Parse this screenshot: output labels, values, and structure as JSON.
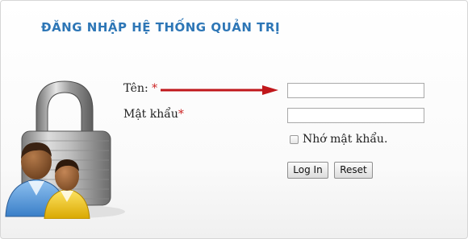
{
  "login": {
    "title": "ĐĂNG NHẬP HỆ THỐNG QUẢN TRỊ",
    "username": {
      "label": "Tên: ",
      "required_mark": "*",
      "value": ""
    },
    "password": {
      "label": "Mật khẩu",
      "required_mark": "*",
      "value": ""
    },
    "remember_label": "Nhớ mật khẩu.",
    "remember_checked": false,
    "login_button": "Log In",
    "reset_button": "Reset"
  },
  "colors": {
    "title": "#2d76b6",
    "required": "#cc2222",
    "arrow": "#c0171b"
  },
  "icons": {
    "illustration": "padlock-users-icon",
    "pointer": "arrow-right-icon"
  }
}
